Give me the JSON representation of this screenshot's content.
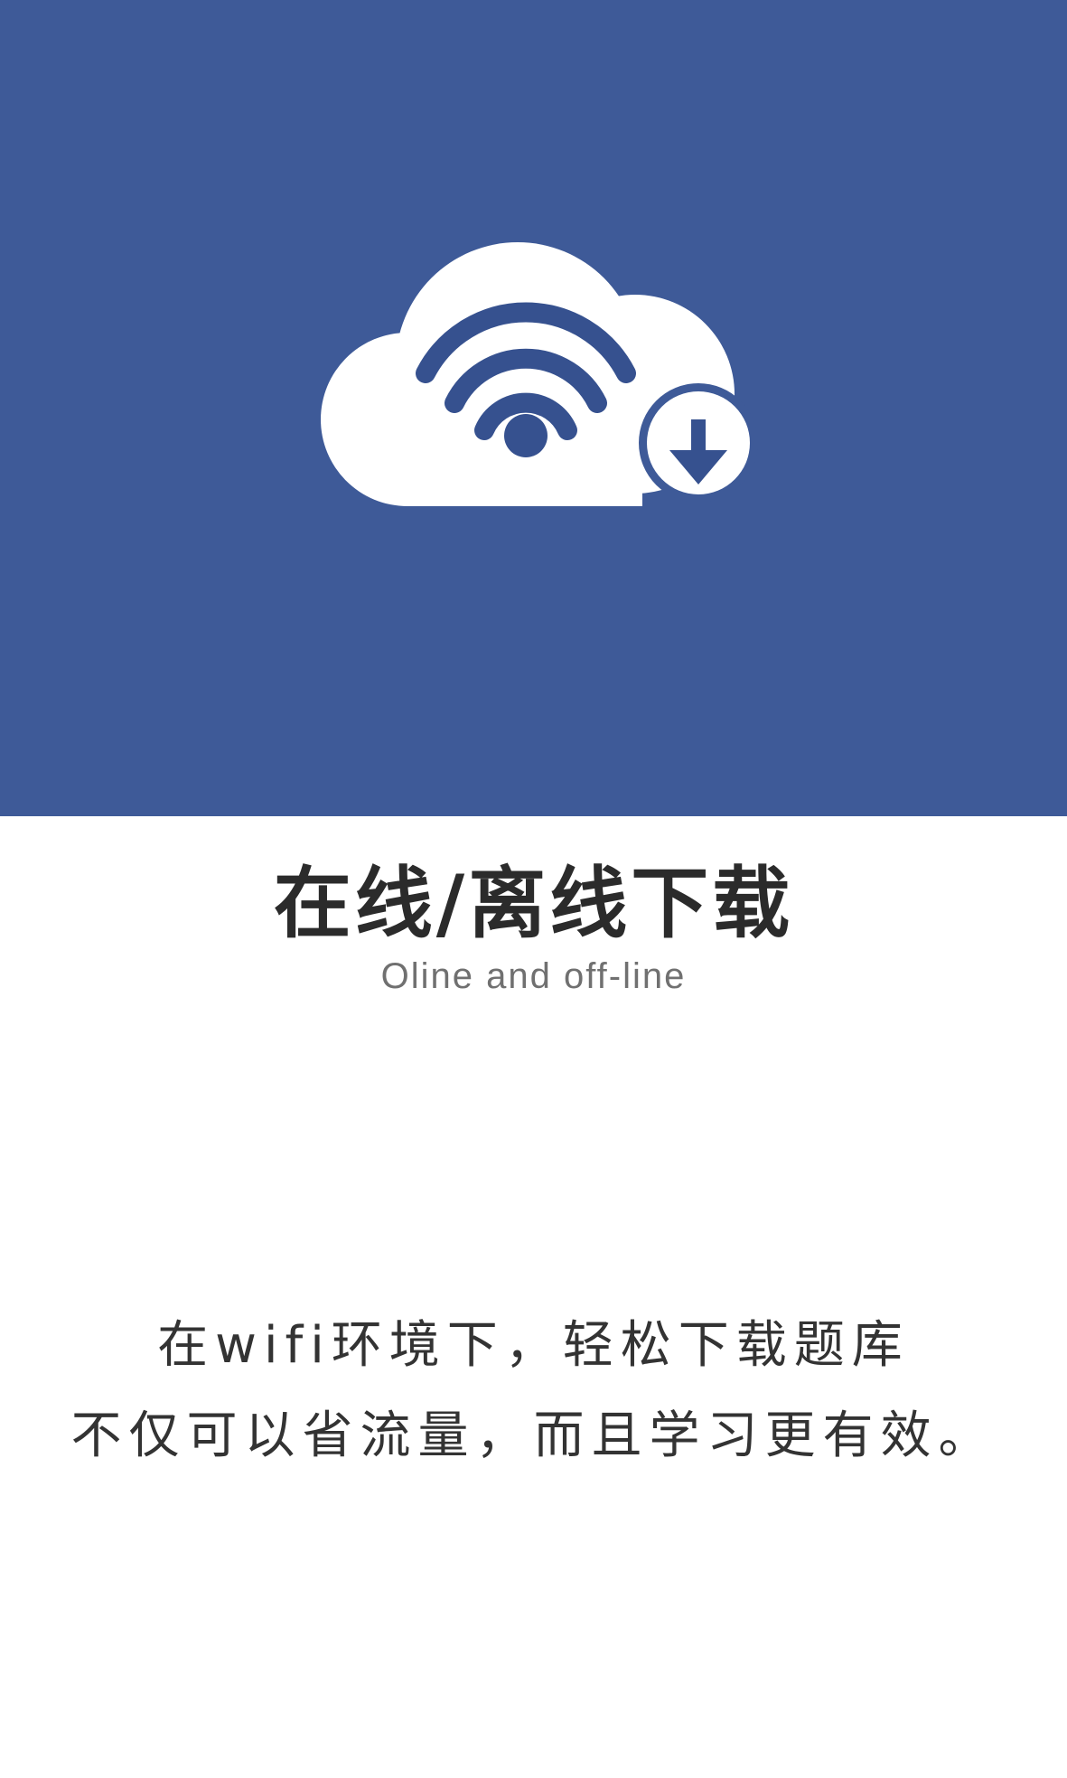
{
  "hero": {
    "background_color": "#3e5a98",
    "icon": "cloud-wifi-download-icon"
  },
  "title": "在线/离线下载",
  "subtitle": "Oline and off-line",
  "description": {
    "line1": "在wifi环境下，轻松下载题库",
    "line2": "不仅可以省流量，而且学习更有效。"
  }
}
